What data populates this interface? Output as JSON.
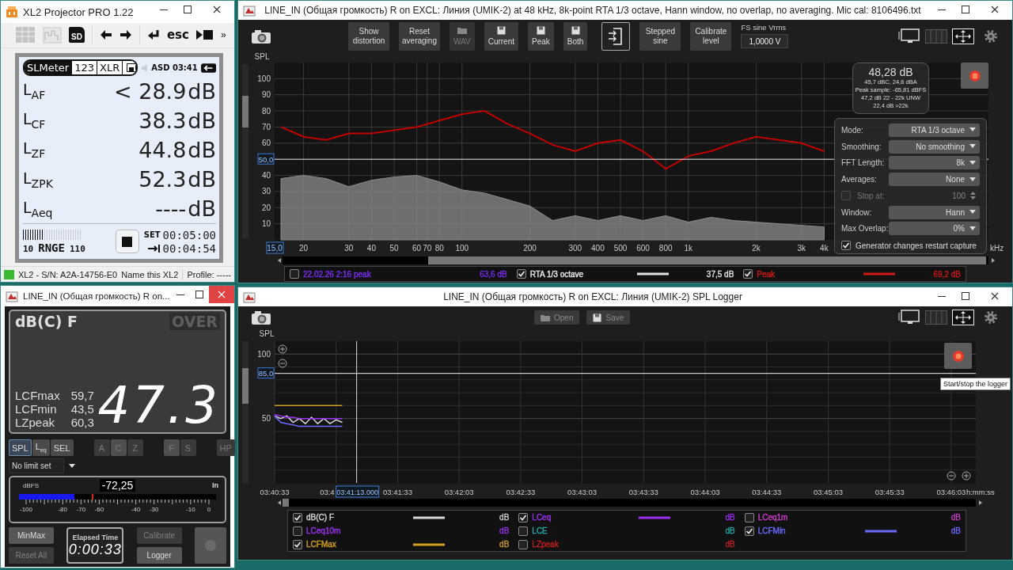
{
  "xl2": {
    "title": "XL2 Projector PRO  1.22",
    "active": false,
    "toolbar": {
      "sd": "SD",
      "esc": "esc",
      "more": "»"
    },
    "tabs": [
      {
        "label": "SLMeter",
        "selected": true
      },
      {
        "label": "123",
        "selected": false
      },
      {
        "label": "XLR",
        "selected": false
      }
    ],
    "clock": "ASD 03:41",
    "readings": [
      {
        "label": "L$_{AF}$",
        "value": "< 28.9",
        "unit": "dB"
      },
      {
        "label": "L$_{CF}$",
        "value": "38.3",
        "unit": "dB"
      },
      {
        "label": "L$_{ZF}$",
        "value": "44.8",
        "unit": "dB"
      },
      {
        "label": "L$_{ZPK}$",
        "value": "52.3",
        "unit": "dB"
      },
      {
        "label": "L$_{Aeq}$",
        "value": "----",
        "unit": "dB"
      }
    ],
    "range": {
      "low": "10",
      "label": "RNGE",
      "high": "110",
      "level": 0.36
    },
    "set_label": "SET",
    "set_time": "00:05:00",
    "remaining_time": "00:04:54",
    "status_bar": {
      "connected": true,
      "device": "XL2 - S/N: A2A-14756-E0",
      "name": "Name this XL2",
      "profile": "Profile:  -----"
    }
  },
  "meter": {
    "title": "LINE_IN (Общая громкость) R on...",
    "active": true,
    "mode": "dB(C) F",
    "over": {
      "label": "OVER",
      "on": false
    },
    "stats": [
      {
        "label": "LCFmax",
        "value": "59,7"
      },
      {
        "label": "LCFmin",
        "value": "43,5"
      },
      {
        "label": "LZpeak",
        "value": "60,3"
      }
    ],
    "reading": "47.3",
    "metric_buttons": [
      {
        "label": "SPL",
        "selected": true
      },
      {
        "label": "L$_{eq}$",
        "selected": false
      },
      {
        "label": "SEL",
        "selected": false
      }
    ],
    "weighting_buttons": [
      {
        "label": "A",
        "selected": false
      },
      {
        "label": "C",
        "selected": true
      },
      {
        "label": "Z",
        "selected": false
      }
    ],
    "time_buttons": [
      {
        "label": "F",
        "selected": true
      },
      {
        "label": "S",
        "selected": false
      }
    ],
    "hp_button": {
      "label": "HP",
      "selected": false
    },
    "limit": "No limit set",
    "dbfs": {
      "label": "dBFS",
      "value": "-72,25",
      "input": "In",
      "level": 0.28,
      "peak": {
        "level": 0.37
      },
      "ticks": [
        "-100",
        "-80",
        "-70",
        "-60",
        "-40",
        "-30",
        "-10",
        "0"
      ]
    },
    "buttons": [
      {
        "label": "MinMax",
        "disabled": false
      },
      {
        "label": "Reset All",
        "disabled": true
      }
    ],
    "elapsed": {
      "label": "Elapsed Time",
      "value": "0:00:33"
    },
    "side_buttons": [
      {
        "label": "Calibrate",
        "disabled": true
      },
      {
        "label": "Logger",
        "disabled": false
      }
    ]
  },
  "rta": {
    "title": "LINE_IN (Общая громкость) R on EXCL: Линия (UMIK-2) at 48 kHz, 8k-point RTA 1/3 octave, Hann window, no overlap, no averaging. Mic cal: 8106496.txt",
    "active": false,
    "toolbar": [
      {
        "kind": "text",
        "label": "Show distortion",
        "disabled": false
      },
      {
        "kind": "text",
        "label": "Reset averaging",
        "disabled": false
      },
      {
        "kind": "open",
        "label": "WAV",
        "disabled": true
      },
      {
        "kind": "save",
        "label": "Current",
        "disabled": false
      },
      {
        "kind": "save",
        "label": "Peak",
        "disabled": false
      },
      {
        "kind": "save",
        "label": "Both",
        "disabled": false
      },
      {
        "kind": "import",
        "disabled": false
      },
      {
        "kind": "text",
        "label": "Stepped sine",
        "disabled": false
      },
      {
        "kind": "text",
        "label": "Calibrate level",
        "disabled": false
      }
    ],
    "fs": {
      "label": "FS sine Vrms",
      "value": "1,0000 V"
    },
    "readout": {
      "main": "48,28 dB",
      "lines": [
        "45,7 dBC, 24,6 dBA",
        "Peak sample: -65,81 dBFS",
        "47,2 dB 22 - 22k UNW",
        "22,4 dB >22k"
      ]
    },
    "settings": [
      {
        "kind": "dropdown",
        "label": "Mode:",
        "value": "RTA 1/3 octave",
        "disabled": false
      },
      {
        "kind": "dropdown",
        "label": "Smoothing:",
        "value": "No smoothing",
        "disabled": false
      },
      {
        "kind": "dropdown",
        "label": "FFT Length:",
        "value": "8k",
        "disabled": false
      },
      {
        "kind": "dropdown",
        "label": "Averages:",
        "value": "None",
        "disabled": false
      },
      {
        "kind": "spinner",
        "label": "Stop at:",
        "value": "100",
        "checked": false,
        "disabled": true
      },
      {
        "kind": "dropdown",
        "label": "Window:",
        "value": "Hann",
        "disabled": false
      },
      {
        "kind": "dropdown",
        "label": "Max Overlap:",
        "value": "0%",
        "disabled": false
      }
    ],
    "restart": {
      "label": "Generator changes restart capture",
      "checked": true
    },
    "x_min_field": "15,0",
    "cursor_field": "50,0",
    "x_extra_label": "70",
    "x_unit": "kHz",
    "chart_data": {
      "type": "line",
      "ylabel": "SPL",
      "grid": true,
      "categories": [
        null,
        "20",
        null,
        "30",
        "40",
        "50",
        "60",
        "80",
        "100",
        null,
        null,
        "200",
        null,
        "300",
        "400",
        "500",
        "600",
        "800",
        "1k",
        null,
        null,
        "2k",
        null,
        "3k",
        "4k"
      ],
      "series": [
        {
          "type": "area",
          "color": "#8c8c8c",
          "values": [
            38,
            40,
            38,
            33,
            37,
            39,
            40,
            36,
            31,
            29,
            25,
            21,
            12,
            15,
            12,
            15,
            12,
            15,
            11,
            14,
            12,
            11,
            10,
            9,
            8
          ]
        },
        {
          "color": "#c00000",
          "values": [
            70,
            64,
            62,
            66,
            66,
            68,
            70,
            74,
            78,
            80,
            72,
            66,
            59,
            55,
            60,
            62,
            55,
            44,
            52,
            55,
            60,
            64,
            62,
            60,
            55
          ]
        }
      ],
      "ylim": [
        0,
        110
      ],
      "yticks": [
        10,
        20,
        30,
        40,
        60,
        70,
        80,
        90,
        100
      ],
      "ref_lines": [
        {
          "axis": "y",
          "value": 50
        }
      ]
    },
    "legend": [
      {
        "label": "22.02.26 2:16 peak",
        "value": "63,6 dB",
        "checked": false,
        "color": "#7b2cf0"
      },
      {
        "label": "RTA 1/3 octave",
        "value": "37,5 dB",
        "checked": true,
        "color": "#e6e6e6"
      },
      {
        "label": "Peak",
        "value": "69,2 dB",
        "checked": true,
        "color": "#d01818"
      }
    ]
  },
  "logger": {
    "title": "LINE_IN (Общая громкость) R on EXCL: Линия (UMIK-2) SPL Logger",
    "active": false,
    "toolbar": [
      {
        "kind": "open",
        "label": "Open",
        "disabled": true
      },
      {
        "kind": "save",
        "label": "Save",
        "disabled": true
      }
    ],
    "tooltip": "Start/stop the logger",
    "cursor_field": "85,0",
    "time_cursor_field": "03:41:13.000",
    "covered_tick": "03:4",
    "chart_data": {
      "type": "line",
      "ylabel": "SPL",
      "xlabel": "h:mm:ss",
      "grid": true,
      "x": [
        13233,
        13236,
        13239,
        13242,
        13245,
        13248,
        13251,
        13254,
        13257,
        13260,
        13263,
        13266
      ],
      "series": [
        {
          "color": "#d8d8d8",
          "values": [
            52,
            50,
            52,
            47,
            50,
            46,
            51,
            46,
            50,
            46,
            49,
            47
          ]
        },
        {
          "color": "#9a30f0",
          "values": [
            53,
            52,
            51,
            51,
            50,
            50,
            50,
            50,
            50,
            50,
            50,
            50
          ]
        },
        {
          "color": "#6a6aff",
          "values": [
            52,
            47,
            46,
            45,
            44,
            44,
            44,
            44,
            44,
            44,
            44,
            44
          ]
        },
        {
          "color": "#d0a020",
          "values": [
            60,
            60,
            60,
            60,
            60,
            60,
            60,
            60,
            60,
            60,
            60,
            60
          ]
        }
      ],
      "xlim": [
        13233,
        13575
      ],
      "ylim": [
        0,
        110
      ],
      "xticks": [
        {
          "value": 13233,
          "label": "03:40:33"
        },
        {
          "value": 13293,
          "label": "03:41:33"
        },
        {
          "value": 13323,
          "label": "03:42:03"
        },
        {
          "value": 13353,
          "label": "03:42:33"
        },
        {
          "value": 13383,
          "label": "03:43:03"
        },
        {
          "value": 13413,
          "label": "03:43:33"
        },
        {
          "value": 13443,
          "label": "03:44:03"
        },
        {
          "value": 13473,
          "label": "03:44:33"
        },
        {
          "value": 13503,
          "label": "03:45:03"
        },
        {
          "value": 13533,
          "label": "03:45:33"
        },
        {
          "value": 13563,
          "label": "03:46:03"
        }
      ],
      "yticks": [
        50,
        100
      ],
      "ref_lines": [
        {
          "axis": "y",
          "value": 85
        },
        {
          "axis": "x",
          "value": 13273
        }
      ]
    },
    "legend": [
      {
        "label": "dB(C) F",
        "checked": true,
        "color": "#d8d8d8",
        "unit": "dB"
      },
      {
        "label": "LCeq",
        "checked": true,
        "color": "#9a30f0",
        "unit": "dB"
      },
      {
        "label": "LCeq1m",
        "checked": false,
        "color": "#c83cc8",
        "unit": "dB"
      },
      {
        "label": "LCeq10m",
        "checked": false,
        "color": "#9a30f0",
        "unit": "dB"
      },
      {
        "label": "LCE",
        "checked": false,
        "color": "#20a8a8",
        "unit": "dB"
      },
      {
        "label": "LCFMin",
        "checked": true,
        "color": "#6a6aff",
        "unit": "dB"
      },
      {
        "label": "LCFMax",
        "checked": true,
        "color": "#d0a020",
        "unit": "dB"
      },
      {
        "label": "LZpeak",
        "checked": false,
        "color": "#c02020",
        "unit": "dB"
      }
    ]
  }
}
